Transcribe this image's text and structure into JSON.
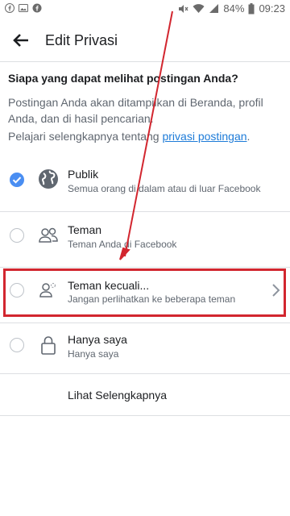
{
  "status_bar": {
    "battery": "84%",
    "time": "09:23",
    "left_icons": [
      "facebook-icon",
      "image-icon",
      "facebook-icon"
    ],
    "right_icons": [
      "mute-icon",
      "wifi-icon",
      "signal-icon",
      "battery-icon"
    ]
  },
  "header": {
    "title": "Edit Privasi",
    "back_icon": "back-arrow-icon"
  },
  "content": {
    "question": "Siapa yang dapat melihat postingan Anda?",
    "description": "Postingan Anda akan ditampilkan di Beranda, profil Anda, dan di hasil pencarian.",
    "learn_prefix": "Pelajari selengkapnya tentang ",
    "learn_link": "privasi postingan",
    "learn_suffix": "."
  },
  "options": [
    {
      "title": "Publik",
      "subtitle": "Semua orang di dalam atau di luar Facebook",
      "icon": "globe-icon",
      "selected": true
    },
    {
      "title": "Teman",
      "subtitle": "Teman Anda di Facebook",
      "icon": "friends-icon",
      "selected": false
    },
    {
      "title": "Teman kecuali...",
      "subtitle": "Jangan perlihatkan ke beberapa teman",
      "icon": "friends-except-icon",
      "selected": false
    },
    {
      "title": "Hanya saya",
      "subtitle": "Hanya saya",
      "icon": "lock-icon",
      "selected": false
    }
  ],
  "see_more": "Lihat Selengkapnya",
  "colors": {
    "accent": "#4a8ef2",
    "link": "#1d7bd8",
    "annotation": "#d2262f",
    "divider": "#dddfe2"
  }
}
